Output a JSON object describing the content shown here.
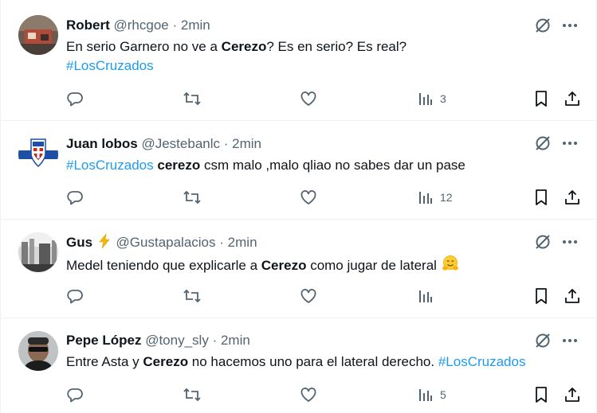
{
  "icons": {
    "grok": "grok-icon",
    "more": "more-icon",
    "reply": "reply-icon",
    "retweet": "retweet-icon",
    "like": "heart-icon",
    "views": "views-icon",
    "bookmark": "bookmark-icon",
    "share": "share-icon"
  },
  "colors": {
    "text": "#0f1419",
    "secondary": "#536471",
    "link": "#1d9bf0",
    "divider": "#eff3f4"
  },
  "tweets": [
    {
      "name": "Robert",
      "handle": "@rhcgoe",
      "sep": "·",
      "time": "2min",
      "line1_a": "En serio Garnero no ve a ",
      "line1_b": "Cerezo",
      "line1_c": "? Es en serio? Es real?",
      "line2": "#LosCruzados",
      "views": "3"
    },
    {
      "name": "Juan lobos",
      "handle": "@Jestebanlc",
      "sep": "·",
      "time": "2min",
      "line1_a": "#LosCruzados",
      "line1_b": "cerezo",
      "line1_c": "csm malo ,malo qliao no sabes dar un pase",
      "views": "12"
    },
    {
      "name": "Gus",
      "handle": "@Gustapalacios",
      "sep": "·",
      "time": "2min",
      "line1_a": "Medel teniendo que explicarle a ",
      "line1_b": "Cerezo",
      "line1_c": " como jugar de lateral",
      "views": ""
    },
    {
      "name": "Pepe López",
      "handle": "@tony_sly",
      "sep": "·",
      "time": "2min",
      "line1_a": "Entre Asta y ",
      "line1_b": "Cerezo",
      "line1_c": " no hacemos uno para el lateral derecho. ",
      "line1_d": "#LosCruzados",
      "views": "5"
    }
  ]
}
